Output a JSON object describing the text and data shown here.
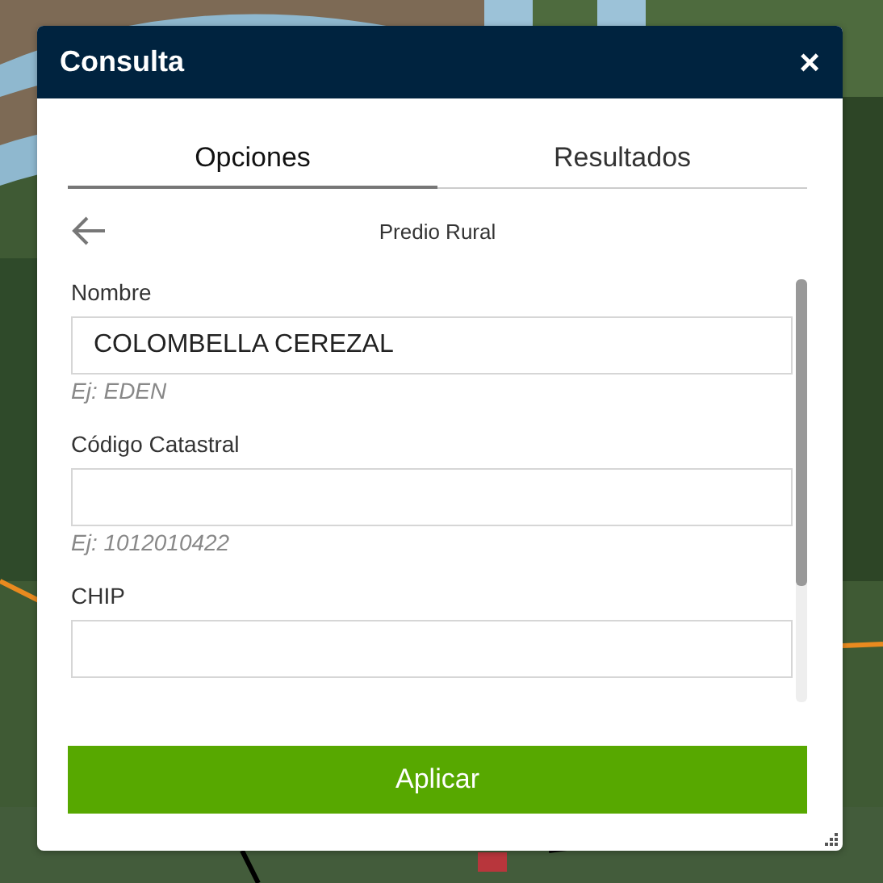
{
  "window": {
    "title": "Consulta",
    "close": "×"
  },
  "tabs": [
    {
      "label": "Opciones",
      "selected": true
    },
    {
      "label": "Resultados",
      "selected": false
    }
  ],
  "subtitle": "Predio Rural",
  "fields": [
    {
      "label": "Nombre",
      "value": "COLOMBELLA CEREZAL",
      "hint": "Ej: EDEN"
    },
    {
      "label": "Código Catastral",
      "hint": "Ej: 1012010422"
    },
    {
      "label": "CHIP"
    }
  ],
  "apply_button": "Aplicar"
}
